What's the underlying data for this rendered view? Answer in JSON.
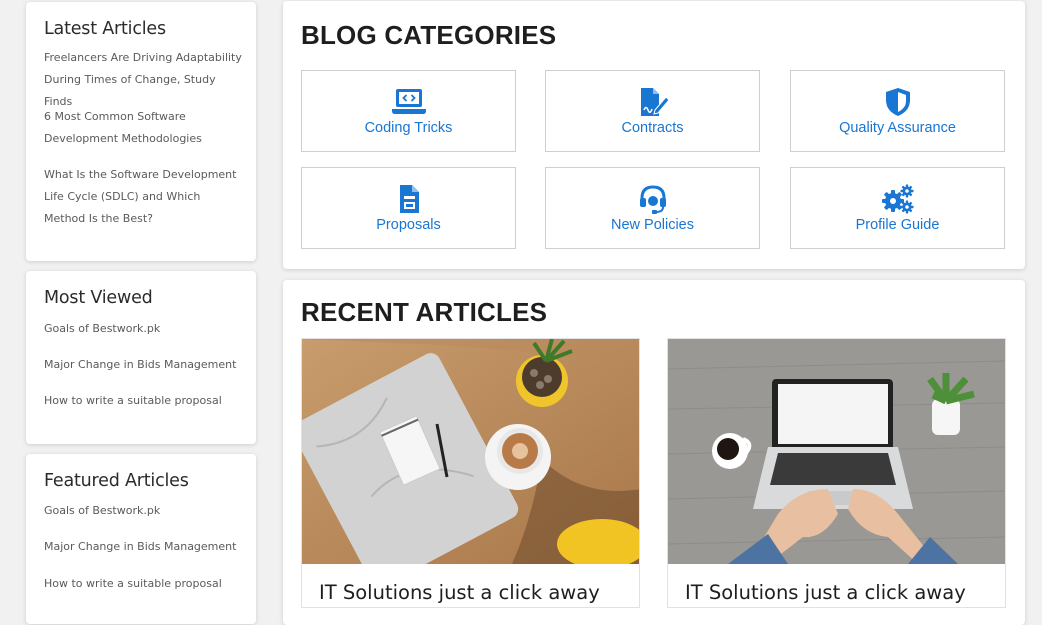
{
  "sidebar": {
    "latest": {
      "title": "Latest Articles",
      "items": [
        "Freelancers Are Driving Adaptability During Times of Change, Study Finds",
        "6 Most Common Software Development Methodologies",
        "What Is the Software Development Life Cycle (SDLC) and Which Method Is the Best?"
      ]
    },
    "most_viewed": {
      "title": "Most Viewed",
      "items": [
        "Goals of Bestwork.pk",
        "Major Change in Bids Management",
        "How to write a suitable proposal"
      ]
    },
    "featured": {
      "title": "Featured Articles",
      "items": [
        "Goals of Bestwork.pk",
        "Major Change in Bids Management",
        "How to write a suitable proposal"
      ]
    }
  },
  "categories": {
    "title": "BLOG CATEGORIES",
    "accent": "#1976d2",
    "items": [
      {
        "label": "Coding Tricks",
        "icon": "laptop-code-icon"
      },
      {
        "label": "Contracts",
        "icon": "file-signature-icon"
      },
      {
        "label": "Quality Assurance",
        "icon": "shield-icon"
      },
      {
        "label": "Proposals",
        "icon": "file-document-icon"
      },
      {
        "label": "New Policies",
        "icon": "headset-icon"
      },
      {
        "label": "Profile Guide",
        "icon": "cogs-icon"
      }
    ]
  },
  "recent": {
    "title": "RECENT ARTICLES",
    "articles": [
      {
        "title": "IT Solutions just a click away",
        "image": "desk-notepad-coffee-photo"
      },
      {
        "title": "IT Solutions just a click away",
        "image": "laptop-typing-photo"
      }
    ]
  }
}
